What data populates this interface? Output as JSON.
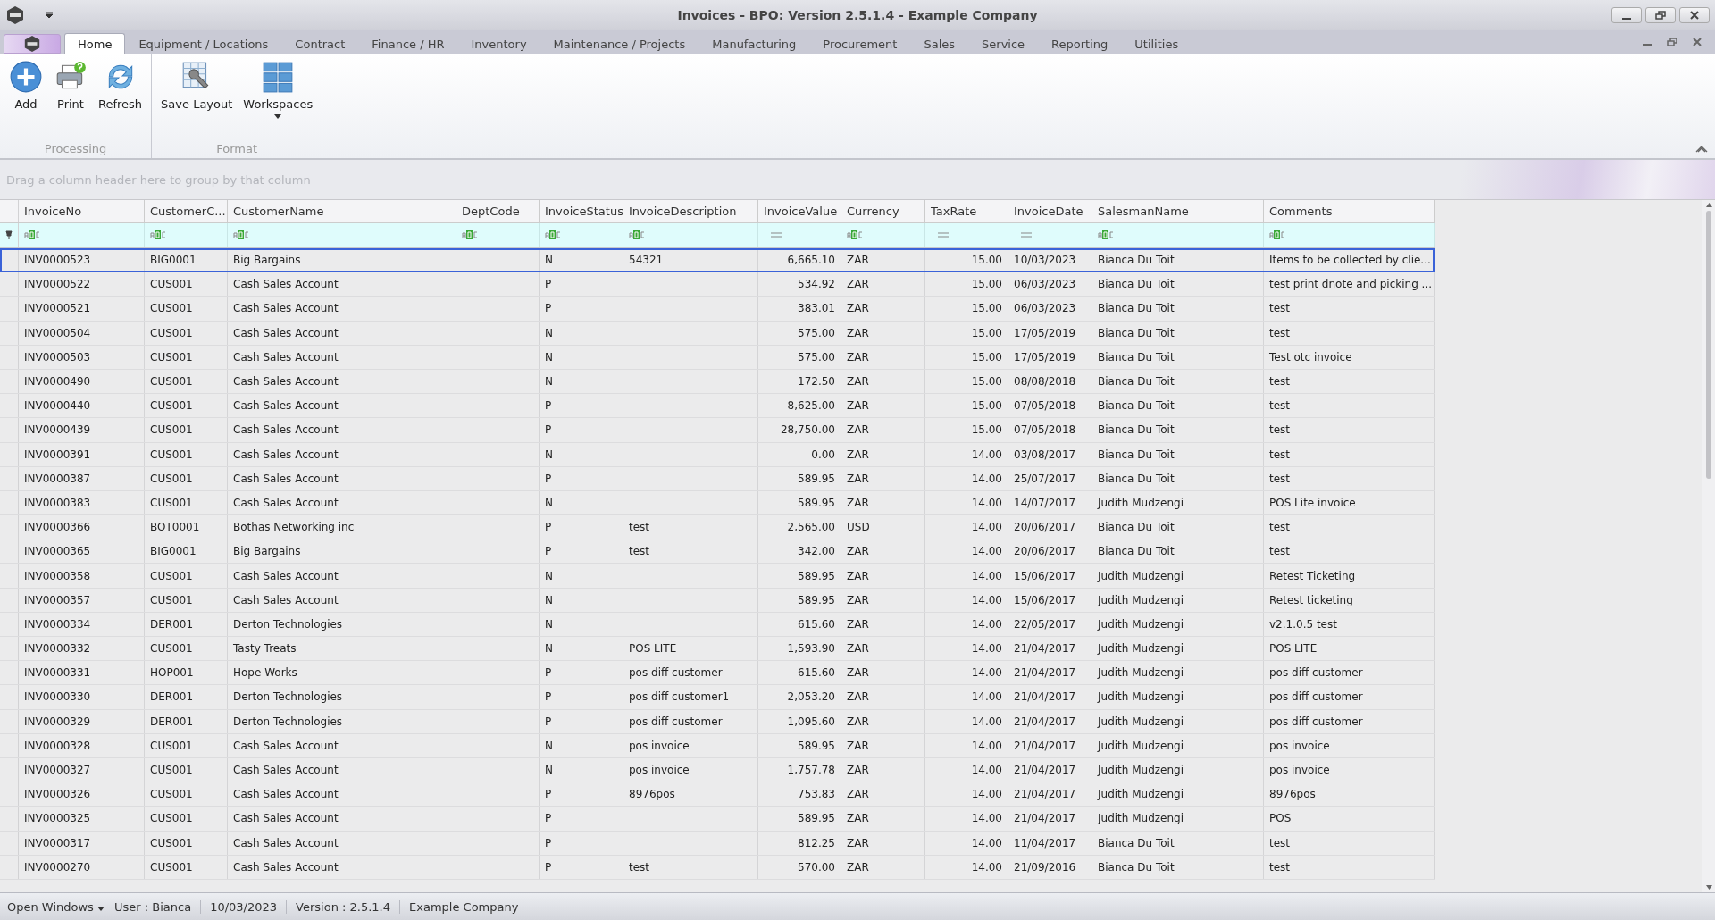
{
  "window": {
    "title": "Invoices - BPO: Version 2.5.1.4 - Example Company"
  },
  "tabs": [
    {
      "label": "Home",
      "selected": true
    },
    {
      "label": "Equipment / Locations",
      "selected": false
    },
    {
      "label": "Contract",
      "selected": false
    },
    {
      "label": "Finance / HR",
      "selected": false
    },
    {
      "label": "Inventory",
      "selected": false
    },
    {
      "label": "Maintenance / Projects",
      "selected": false
    },
    {
      "label": "Manufacturing",
      "selected": false
    },
    {
      "label": "Procurement",
      "selected": false
    },
    {
      "label": "Sales",
      "selected": false
    },
    {
      "label": "Service",
      "selected": false
    },
    {
      "label": "Reporting",
      "selected": false
    },
    {
      "label": "Utilities",
      "selected": false
    }
  ],
  "ribbon_groups": [
    {
      "label": "Processing",
      "buttons": [
        {
          "label": "Add",
          "kind": "add",
          "dropdown": false
        },
        {
          "label": "Print",
          "kind": "print",
          "dropdown": false
        },
        {
          "label": "Refresh",
          "kind": "refresh",
          "dropdown": false
        }
      ]
    },
    {
      "label": "Format",
      "buttons": [
        {
          "label": "Save Layout",
          "kind": "layout",
          "dropdown": false
        },
        {
          "label": "Workspaces",
          "kind": "workspaces",
          "dropdown": true
        }
      ]
    }
  ],
  "group_panel": {
    "placeholder": "Drag a column header here to group by that column"
  },
  "table": {
    "columns": [
      {
        "label": "InvoiceNo",
        "kind": "text"
      },
      {
        "label": "CustomerC...",
        "kind": "text"
      },
      {
        "label": "CustomerName",
        "kind": "text"
      },
      {
        "label": "DeptCode",
        "kind": "text"
      },
      {
        "label": "InvoiceStatus",
        "kind": "text"
      },
      {
        "label": "InvoiceDescription",
        "kind": "text"
      },
      {
        "label": "InvoiceValue",
        "kind": "number"
      },
      {
        "label": "Currency",
        "kind": "text"
      },
      {
        "label": "TaxRate",
        "kind": "number"
      },
      {
        "label": "InvoiceDate",
        "kind": "date"
      },
      {
        "label": "SalesmanName",
        "kind": "text"
      },
      {
        "label": "Comments",
        "kind": "text"
      }
    ],
    "rows": [
      {
        "selected": true,
        "cells": [
          "INV0000523",
          "BIG0001",
          "Big Bargains",
          "",
          "N",
          "54321",
          "6,665.10",
          "ZAR",
          "15.00",
          "10/03/2023",
          "Bianca Du Toit",
          "Items to be collected by clie..."
        ]
      },
      {
        "selected": false,
        "cells": [
          "INV0000522",
          "CUS001",
          "Cash Sales Account",
          "",
          "P",
          "",
          "534.92",
          "ZAR",
          "15.00",
          "06/03/2023",
          "Bianca Du Toit",
          "test print dnote and picking ..."
        ]
      },
      {
        "selected": false,
        "cells": [
          "INV0000521",
          "CUS001",
          "Cash Sales Account",
          "",
          "P",
          "",
          "383.01",
          "ZAR",
          "15.00",
          "06/03/2023",
          "Bianca Du Toit",
          "test"
        ]
      },
      {
        "selected": false,
        "cells": [
          "INV0000504",
          "CUS001",
          "Cash Sales Account",
          "",
          "N",
          "",
          "575.00",
          "ZAR",
          "15.00",
          "17/05/2019",
          "Bianca Du Toit",
          "test"
        ]
      },
      {
        "selected": false,
        "cells": [
          "INV0000503",
          "CUS001",
          "Cash Sales Account",
          "",
          "N",
          "",
          "575.00",
          "ZAR",
          "15.00",
          "17/05/2019",
          "Bianca Du Toit",
          "Test otc invoice"
        ]
      },
      {
        "selected": false,
        "cells": [
          "INV0000490",
          "CUS001",
          "Cash Sales Account",
          "",
          "N",
          "",
          "172.50",
          "ZAR",
          "15.00",
          "08/08/2018",
          "Bianca Du Toit",
          "test"
        ]
      },
      {
        "selected": false,
        "cells": [
          "INV0000440",
          "CUS001",
          "Cash Sales Account",
          "",
          "P",
          "",
          "8,625.00",
          "ZAR",
          "15.00",
          "07/05/2018",
          "Bianca Du Toit",
          "test"
        ]
      },
      {
        "selected": false,
        "cells": [
          "INV0000439",
          "CUS001",
          "Cash Sales Account",
          "",
          "P",
          "",
          "28,750.00",
          "ZAR",
          "15.00",
          "07/05/2018",
          "Bianca Du Toit",
          "test"
        ]
      },
      {
        "selected": false,
        "cells": [
          "INV0000391",
          "CUS001",
          "Cash Sales Account",
          "",
          "N",
          "",
          "0.00",
          "ZAR",
          "14.00",
          "03/08/2017",
          "Bianca Du Toit",
          "test"
        ]
      },
      {
        "selected": false,
        "cells": [
          "INV0000387",
          "CUS001",
          "Cash Sales Account",
          "",
          "P",
          "",
          "589.95",
          "ZAR",
          "14.00",
          "25/07/2017",
          "Bianca Du Toit",
          "test"
        ]
      },
      {
        "selected": false,
        "cells": [
          "INV0000383",
          "CUS001",
          "Cash Sales Account",
          "",
          "N",
          "",
          "589.95",
          "ZAR",
          "14.00",
          "14/07/2017",
          "Judith Mudzengi",
          "POS Lite invoice"
        ]
      },
      {
        "selected": false,
        "cells": [
          "INV0000366",
          "BOT0001",
          "Bothas Networking inc",
          "",
          "P",
          "test",
          "2,565.00",
          "USD",
          "14.00",
          "20/06/2017",
          "Bianca Du Toit",
          "test"
        ]
      },
      {
        "selected": false,
        "cells": [
          "INV0000365",
          "BIG0001",
          "Big Bargains",
          "",
          "P",
          "test",
          "342.00",
          "ZAR",
          "14.00",
          "20/06/2017",
          "Bianca Du Toit",
          "test"
        ]
      },
      {
        "selected": false,
        "cells": [
          "INV0000358",
          "CUS001",
          "Cash Sales Account",
          "",
          "N",
          "",
          "589.95",
          "ZAR",
          "14.00",
          "15/06/2017",
          "Judith Mudzengi",
          "Retest Ticketing"
        ]
      },
      {
        "selected": false,
        "cells": [
          "INV0000357",
          "CUS001",
          "Cash Sales Account",
          "",
          "N",
          "",
          "589.95",
          "ZAR",
          "14.00",
          "15/06/2017",
          "Judith Mudzengi",
          "Retest ticketing"
        ]
      },
      {
        "selected": false,
        "cells": [
          "INV0000334",
          "DER001",
          "Derton Technologies",
          "",
          "N",
          "",
          "615.60",
          "ZAR",
          "14.00",
          "22/05/2017",
          "Judith Mudzengi",
          "v2.1.0.5 test"
        ]
      },
      {
        "selected": false,
        "cells": [
          "INV0000332",
          "CUS001",
          "Tasty Treats",
          "",
          "N",
          "POS LITE",
          "1,593.90",
          "ZAR",
          "14.00",
          "21/04/2017",
          "Judith Mudzengi",
          "POS LITE"
        ]
      },
      {
        "selected": false,
        "cells": [
          "INV0000331",
          "HOP001",
          "Hope Works",
          "",
          "P",
          "pos diff customer",
          "615.60",
          "ZAR",
          "14.00",
          "21/04/2017",
          "Judith Mudzengi",
          "pos diff customer"
        ]
      },
      {
        "selected": false,
        "cells": [
          "INV0000330",
          "DER001",
          "Derton Technologies",
          "",
          "P",
          "pos diff customer1",
          "2,053.20",
          "ZAR",
          "14.00",
          "21/04/2017",
          "Judith Mudzengi",
          "pos diff customer"
        ]
      },
      {
        "selected": false,
        "cells": [
          "INV0000329",
          "DER001",
          "Derton Technologies",
          "",
          "P",
          "pos diff customer",
          "1,095.60",
          "ZAR",
          "14.00",
          "21/04/2017",
          "Judith Mudzengi",
          "pos diff customer"
        ]
      },
      {
        "selected": false,
        "cells": [
          "INV0000328",
          "CUS001",
          "Cash Sales Account",
          "",
          "N",
          "pos invoice",
          "589.95",
          "ZAR",
          "14.00",
          "21/04/2017",
          "Judith Mudzengi",
          "pos invoice"
        ]
      },
      {
        "selected": false,
        "cells": [
          "INV0000327",
          "CUS001",
          "Cash Sales Account",
          "",
          "N",
          "pos invoice",
          "1,757.78",
          "ZAR",
          "14.00",
          "21/04/2017",
          "Judith Mudzengi",
          "pos invoice"
        ]
      },
      {
        "selected": false,
        "cells": [
          "INV0000326",
          "CUS001",
          "Cash Sales Account",
          "",
          "P",
          "8976pos",
          "753.83",
          "ZAR",
          "14.00",
          "21/04/2017",
          "Judith Mudzengi",
          "8976pos"
        ]
      },
      {
        "selected": false,
        "cells": [
          "INV0000325",
          "CUS001",
          "Cash Sales Account",
          "",
          "P",
          "",
          "589.95",
          "ZAR",
          "14.00",
          "21/04/2017",
          "Judith Mudzengi",
          "POS"
        ]
      },
      {
        "selected": false,
        "cells": [
          "INV0000317",
          "CUS001",
          "Cash Sales Account",
          "",
          "P",
          "",
          "812.25",
          "ZAR",
          "14.00",
          "11/04/2017",
          "Bianca Du Toit",
          "test"
        ]
      },
      {
        "selected": false,
        "cells": [
          "INV0000270",
          "CUS001",
          "Cash Sales Account",
          "",
          "P",
          "test",
          "570.00",
          "ZAR",
          "14.00",
          "21/09/2016",
          "Bianca Du Toit",
          "test"
        ]
      }
    ]
  },
  "status_bar": {
    "left": "Open Windows",
    "items": [
      "User : Bianca",
      "10/03/2023",
      "Version : 2.5.1.4",
      "Example Company"
    ]
  }
}
